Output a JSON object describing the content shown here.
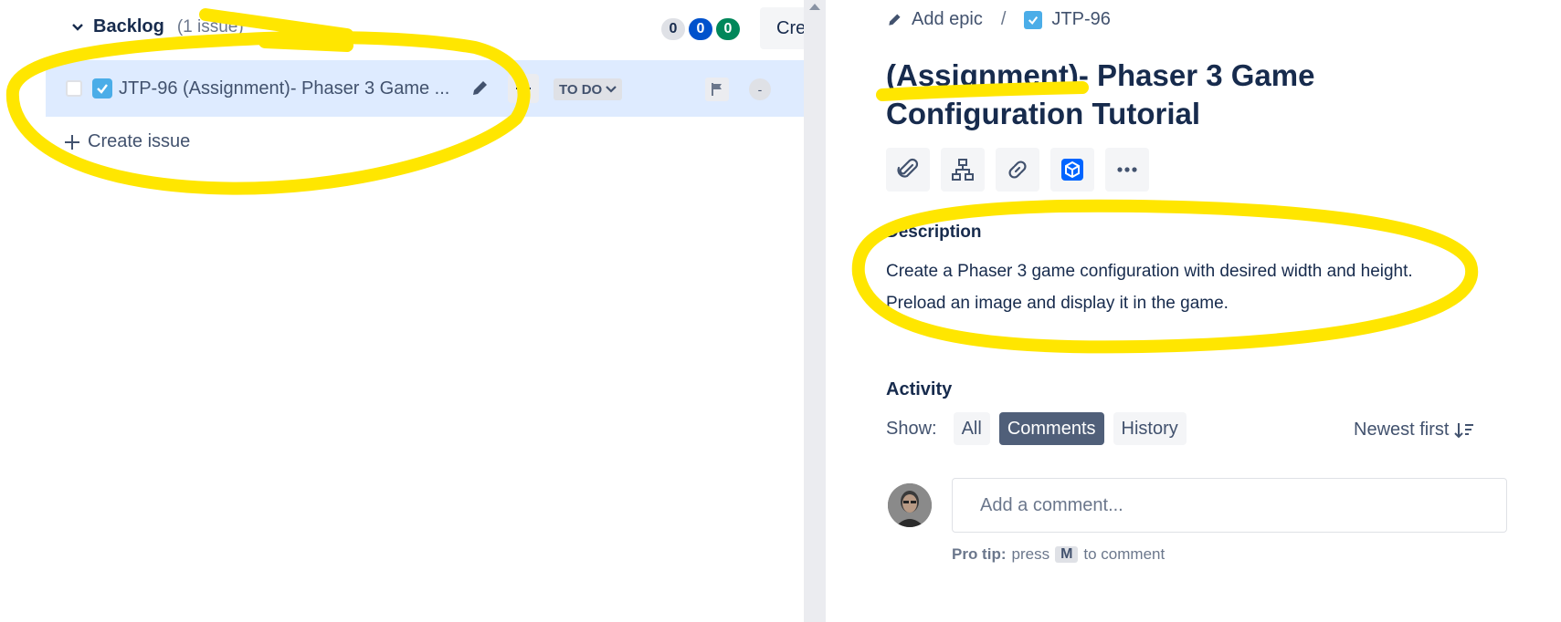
{
  "backlog": {
    "title": "Backlog",
    "count": "(1 issue)",
    "status_counts": [
      "0",
      "0",
      "0"
    ],
    "create_button": "Cre",
    "create_issue": "Create issue",
    "issue": {
      "text": "JTP-96 (Assignment)- Phaser 3 Game ...",
      "status": "TO DO",
      "assignee": "-"
    }
  },
  "detail": {
    "breadcrumb": {
      "add_epic": "Add epic",
      "separator": "/",
      "issue_key": "JTP-96"
    },
    "title": "(Assignment)- Phaser 3 Game Configuration Tutorial",
    "description_heading": "Description",
    "description_lines": [
      "Create a Phaser 3 game configuration with desired width and height.",
      "Preload an image and display it in the game."
    ],
    "activity": {
      "heading": "Activity",
      "show_label": "Show:",
      "filters": [
        "All",
        "Comments",
        "History"
      ],
      "sort": "Newest first",
      "comment_placeholder": "Add a comment...",
      "protip_bold": "Pro tip:",
      "protip_press": "press",
      "protip_key": "M",
      "protip_tail": "to comment"
    }
  },
  "colors": {
    "highlighter": "#ffe600",
    "selected_row": "#deebff",
    "primary": "#0052cc",
    "success": "#00875a"
  }
}
